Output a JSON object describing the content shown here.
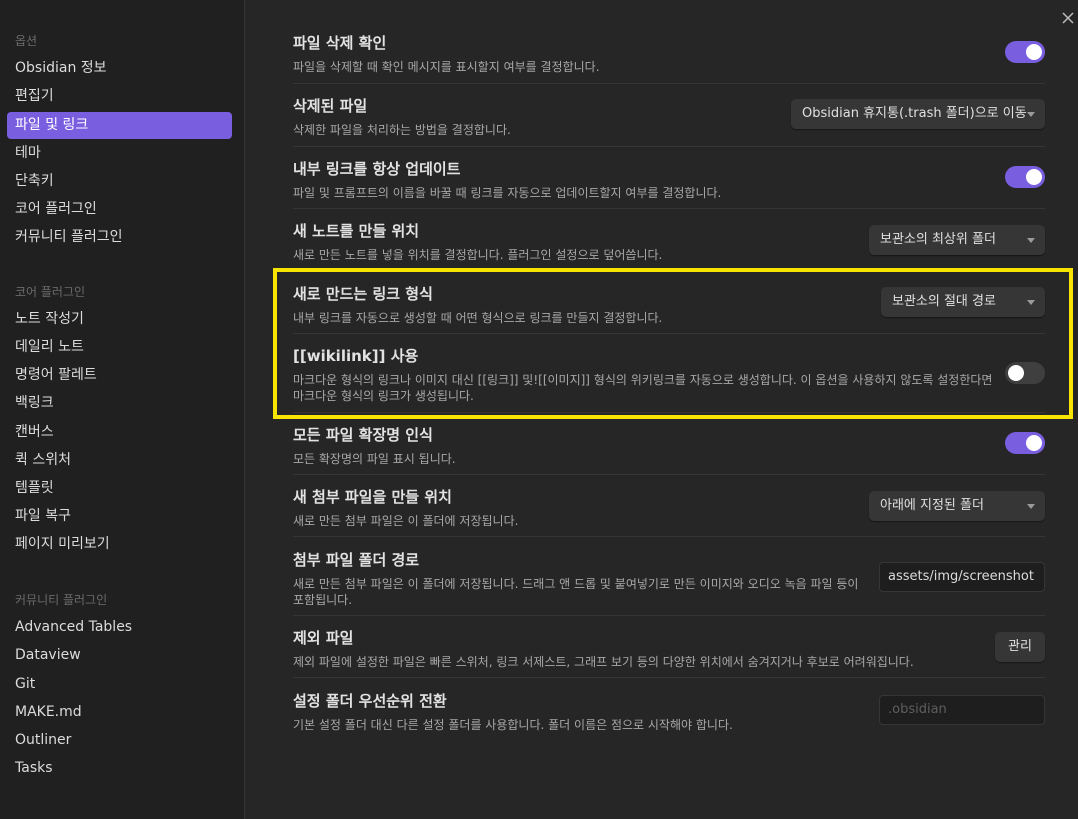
{
  "sidebar": {
    "sections": [
      {
        "title": "옵션",
        "items": [
          "Obsidian 정보",
          "편집기",
          "파일 및 링크",
          "테마",
          "단축키",
          "코어 플러그인",
          "커뮤니티 플러그인"
        ]
      },
      {
        "title": "코어 플러그인",
        "items": [
          "노트 작성기",
          "데일리 노트",
          "명령어 팔레트",
          "백링크",
          "캔버스",
          "퀵 스위처",
          "템플릿",
          "파일 복구",
          "페이지 미리보기"
        ]
      },
      {
        "title": "커뮤니티 플러그인",
        "items": [
          "Advanced Tables",
          "Dataview",
          "Git",
          "MAKE.md",
          "Outliner",
          "Tasks"
        ]
      }
    ],
    "active_item": "파일 및 링크"
  },
  "settings": [
    {
      "title": "파일 삭제 확인",
      "desc": "파일을 삭제할 때 확인 메시지를 표시할지 여부를 결정합니다.",
      "control": "toggle",
      "on": true
    },
    {
      "title": "삭제된 파일",
      "desc": "삭제한 파일을 처리하는 방법을 결정합니다.",
      "control": "dropdown",
      "value": "Obsidian 휴지통(.trash 폴더)으로 이동"
    },
    {
      "title": "내부 링크를 항상 업데이트",
      "desc": "파일 및 프롬프트의 이름을 바꿀 때 링크를 자동으로 업데이트할지 여부를 결정합니다.",
      "control": "toggle",
      "on": true
    },
    {
      "title": "새 노트를 만들 위치",
      "desc": "새로 만든 노트를 넣을 위치를 결정합니다. 플러그인 설정으로 덮어씁니다.",
      "control": "dropdown",
      "value": "보관소의 최상위 폴더"
    },
    {
      "title": "새로 만드는 링크 형식",
      "desc": "내부 링크를 자동으로 생성할 때 어떤 형식으로 링크를 만들지 결정합니다.",
      "control": "dropdown",
      "value": "보관소의 절대 경로"
    },
    {
      "title": "[[wikilink]] 사용",
      "desc": "마크다운 형식의 링크나 이미지 대신 [[링크]] 및![[이미지]] 형식의 위키링크를 자동으로 생성합니다. 이 옵션을 사용하지 않도록 설정한다면 마크다운 형식의 링크가 생성됩니다.",
      "control": "toggle",
      "on": false
    },
    {
      "title": "모든 파일 확장명 인식",
      "desc": "모든 확장명의 파일 표시 됩니다.",
      "control": "toggle",
      "on": true
    },
    {
      "title": "새 첨부 파일을 만들 위치",
      "desc": "새로 만든 첨부 파일은 이 폴더에 저장됩니다.",
      "control": "dropdown",
      "value": "아래에 지정된 폴더"
    },
    {
      "title": "첨부 파일 폴더 경로",
      "desc": "새로 만든 첨부 파일은 이 폴더에 저장됩니다. 드래그 앤 드롭 및 붙여넣기로 만든 이미지와 오디오 녹음 파일 등이 포함됩니다.",
      "control": "text",
      "value": "assets/img/screenshot"
    },
    {
      "title": "제외 파일",
      "desc": "제외 파일에 설정한 파일은 빠른 스위처, 링크 서제스트, 그래프 보기 등의 다양한 위치에서 숨겨지거나 후보로 어려워집니다.",
      "control": "button",
      "value": "관리"
    },
    {
      "title": "설정 폴더 우선순위 전환",
      "desc": "기본 설정 폴더 대신 다른 설정 폴더를 사용합니다. 폴더 이름은 점으로 시작해야 합니다.",
      "control": "text",
      "placeholder": ".obsidian"
    }
  ],
  "colors": {
    "accent": "#7a5ee0",
    "highlight": "#f7e400",
    "bg": "#262626",
    "sidebar_bg": "#202020"
  }
}
